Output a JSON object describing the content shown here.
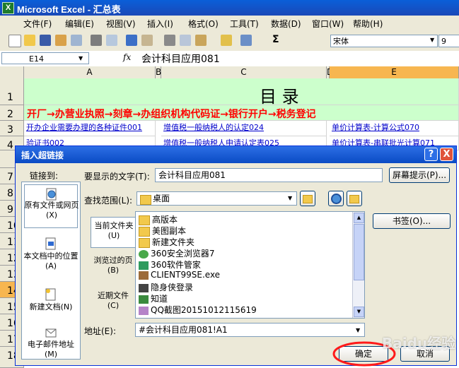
{
  "window": {
    "title": "Microsoft Excel - 汇总表",
    "app_icon": "excel-icon"
  },
  "menu": [
    "文件(F)",
    "编辑(E)",
    "视图(V)",
    "插入(I)",
    "格式(O)",
    "工具(T)",
    "数据(D)",
    "窗口(W)",
    "帮助(H)"
  ],
  "toolbar": {
    "font_name": "宋体",
    "font_size": "9",
    "sigma": "Σ"
  },
  "formula_bar": {
    "name_box": "E14",
    "fx": "fx",
    "formula": "会计科目应用081"
  },
  "columns": [
    "A",
    "B",
    "C",
    "D",
    "E"
  ],
  "rows": [
    "1",
    "2",
    "3",
    "4",
    "7",
    "8",
    "9",
    "10",
    "11",
    "12",
    "13",
    "14",
    "15",
    "16",
    "17",
    "18"
  ],
  "sheet": {
    "title": "目    录",
    "flow": "开厂→办营业执照→刻章→办组织机构代码证→银行开户→税务登记",
    "row3": [
      "开办企业需要办理的各种证件001",
      "增值税一般纳税人的认定024",
      "单价计算表-计算公式070"
    ],
    "row4": [
      "验证书002",
      "增值税一般纳税人申请认定表025",
      "单价计算表-串联批光计算071"
    ]
  },
  "dialog": {
    "title": "插入超链接",
    "help": "?",
    "close": "X",
    "link_to_label": "链接到:",
    "link_to": [
      {
        "label": "原有文件或网页(X)",
        "icon": "globe-page-icon"
      },
      {
        "label": "本文档中的位置(A)",
        "icon": "document-place-icon"
      },
      {
        "label": "新建文档(N)",
        "icon": "new-document-icon"
      },
      {
        "label": "电子邮件地址(M)",
        "icon": "email-icon"
      }
    ],
    "display_text_label": "要显示的文字(T):",
    "display_text": "会计科目应用081",
    "screen_tip": "屏幕提示(P)...",
    "look_in_label": "查找范围(L):",
    "look_in": "桌面",
    "tabs": [
      {
        "label": "当前文件夹(U)"
      },
      {
        "label": "浏览过的页(B)"
      },
      {
        "label": "近期文件(C)"
      }
    ],
    "files": [
      {
        "name": "高版本",
        "icon": "folder-icon"
      },
      {
        "name": "美图副本",
        "icon": "folder-icon"
      },
      {
        "name": "新建文件夹",
        "icon": "folder-icon"
      },
      {
        "name": "360安全浏览器7",
        "icon": "browser-icon"
      },
      {
        "name": "360软件管家",
        "icon": "app-icon"
      },
      {
        "name": "CLIENT99SE.exe",
        "icon": "exe-icon"
      },
      {
        "name": "隐身侠登录",
        "icon": "app-icon"
      },
      {
        "name": "知道",
        "icon": "app-icon"
      },
      {
        "name": "QQ截图20151012115619",
        "icon": "image-icon"
      }
    ],
    "bookmark": "书签(O)...",
    "address_label": "地址(E):",
    "address": "#会计科目应用081!A1",
    "ok": "确定",
    "cancel": "取消"
  },
  "watermark": "Baidu经验"
}
